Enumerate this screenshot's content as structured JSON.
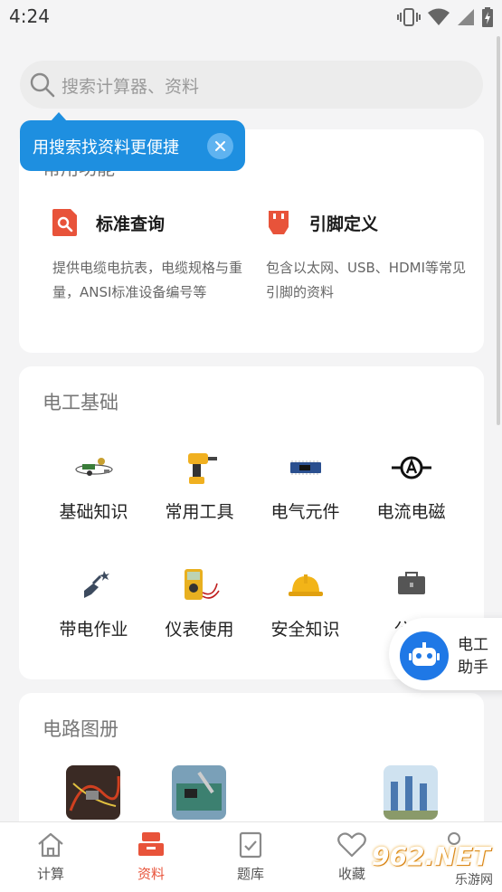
{
  "status_bar": {
    "time": "4:24"
  },
  "search": {
    "placeholder": "搜索计算器、资料"
  },
  "tooltip": {
    "text": "用搜索找资料更便捷"
  },
  "top_card": {
    "title": "常用功能",
    "features": [
      {
        "title": "标准查询",
        "desc": "提供电缆电抗表，电缆规格与重量，ANSI标准设备编号等",
        "icon": "search-document-icon"
      },
      {
        "title": "引脚定义",
        "desc": "包含以太网、USB、HDMI等常见引脚的资料",
        "icon": "connector-pin-icon"
      }
    ]
  },
  "basics": {
    "title": "电工基础",
    "items": [
      {
        "label": "基础知识",
        "icon": "circuit-basics-icon"
      },
      {
        "label": "常用工具",
        "icon": "power-drill-icon"
      },
      {
        "label": "电气元件",
        "icon": "circuit-board-icon"
      },
      {
        "label": "电流电磁",
        "icon": "ammeter-symbol-icon"
      },
      {
        "label": "带电作业",
        "icon": "live-work-icon"
      },
      {
        "label": "仪表使用",
        "icon": "multimeter-icon"
      },
      {
        "label": "安全知识",
        "icon": "safety-helmet-icon"
      },
      {
        "label": "公式",
        "icon": "toolbox-icon"
      }
    ]
  },
  "circuits": {
    "title": "电路图册",
    "thumbs": [
      "wiring-photo",
      "circuit-board-photo",
      "substation-photo"
    ]
  },
  "assistant": {
    "label": "电工助手"
  },
  "tabs": [
    {
      "label": "计算",
      "icon": "home-icon",
      "active": false
    },
    {
      "label": "资料",
      "icon": "folder-stack-icon",
      "active": true
    },
    {
      "label": "题库",
      "icon": "checklist-icon",
      "active": false
    },
    {
      "label": "收藏",
      "icon": "heart-icon",
      "active": false
    }
  ],
  "watermark": {
    "brand": "962.NET",
    "sub": "乐游网"
  },
  "colors": {
    "accent": "#e8533a",
    "tooltip": "#1e8fe0",
    "assistant": "#1f78e6"
  }
}
